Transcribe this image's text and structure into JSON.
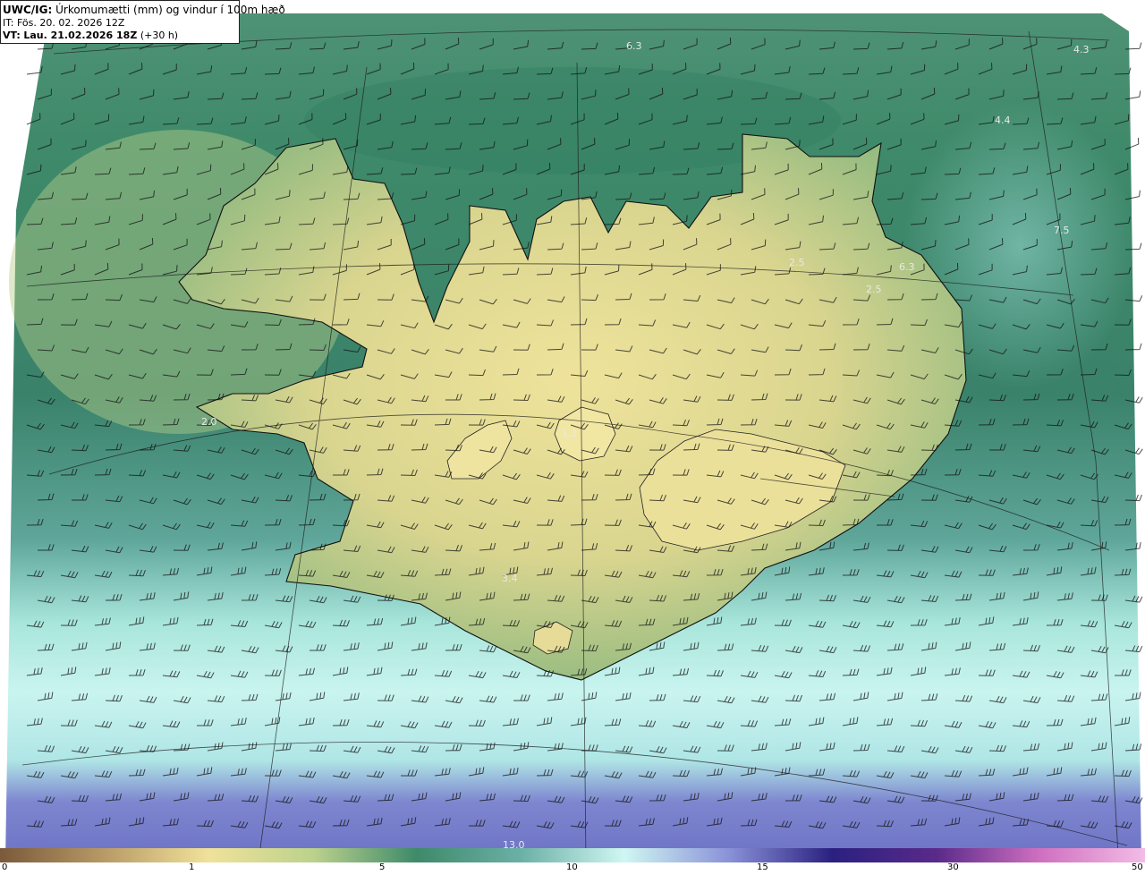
{
  "header": {
    "model": "UWC/IG:",
    "title": "Úrkomumætti (mm) og vindur í 100m hæð",
    "it_label": "IT:",
    "it_value": "Fös. 20. 02. 2026 12Z",
    "vt_label": "VT:",
    "vt_value": "Lau. 21.02.2026 18Z",
    "vt_offset": "(+30 h)"
  },
  "map_labels": [
    {
      "id": "pw-1",
      "text": "6.3"
    },
    {
      "id": "pw-2",
      "text": "4.3"
    },
    {
      "id": "pw-3",
      "text": "4.4"
    },
    {
      "id": "pw-4",
      "text": "7.5"
    },
    {
      "id": "pw-5",
      "text": "2.5"
    },
    {
      "id": "pw-6",
      "text": "6.3"
    },
    {
      "id": "pw-7",
      "text": "2.5"
    },
    {
      "id": "pw-8",
      "text": "2.0"
    },
    {
      "id": "pw-9",
      "text": "1.2"
    },
    {
      "id": "pw-10",
      "text": "3.4"
    },
    {
      "id": "pw-11",
      "text": "13.0"
    }
  ],
  "colorbar": {
    "ticks": [
      "0",
      "1",
      "5",
      "10",
      "15",
      "30",
      "50"
    ],
    "colors": [
      "#7a5a3a",
      "#b89a66",
      "#f0e29a",
      "#bcd28c",
      "#3e8a6a",
      "#6bb0a6",
      "#cff7f2",
      "#8a92d8",
      "#2a2080",
      "#5a2a8a",
      "#d070c0",
      "#f2bde6"
    ]
  }
}
